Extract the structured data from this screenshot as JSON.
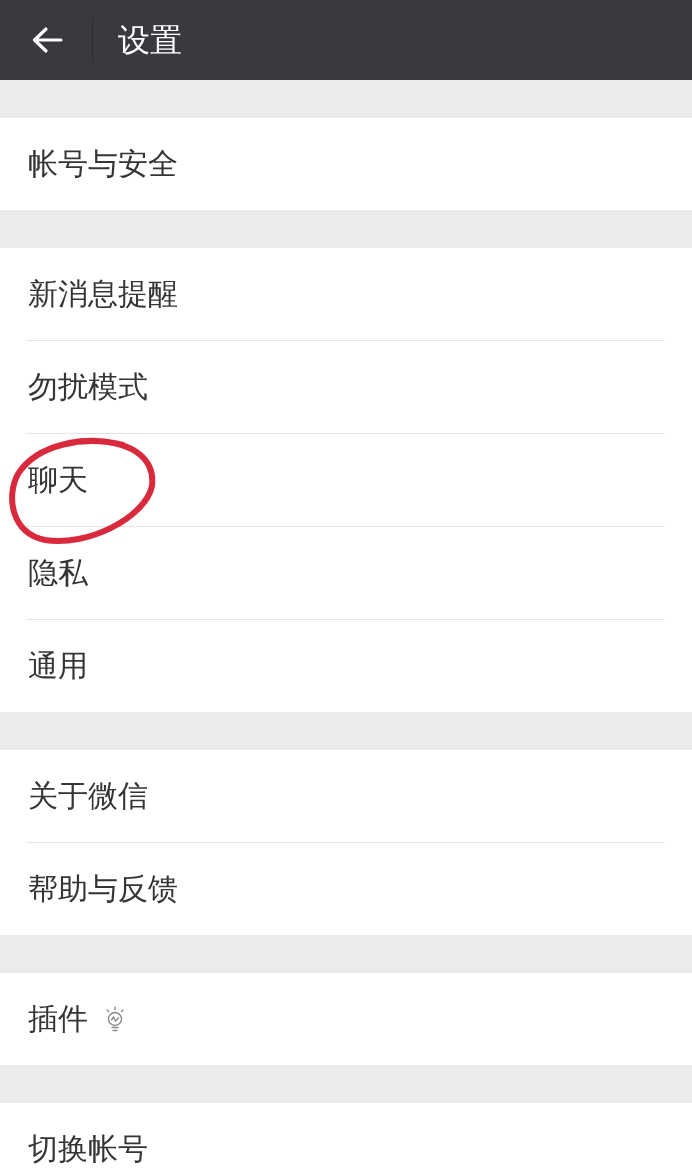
{
  "header": {
    "title": "设置"
  },
  "groups": [
    {
      "items": [
        {
          "label": "帐号与安全",
          "kind": "plain",
          "circled": false
        }
      ]
    },
    {
      "items": [
        {
          "label": "新消息提醒",
          "kind": "plain",
          "circled": false
        },
        {
          "label": "勿扰模式",
          "kind": "plain",
          "circled": false
        },
        {
          "label": "聊天",
          "kind": "plain",
          "circled": true
        },
        {
          "label": "隐私",
          "kind": "plain",
          "circled": false
        },
        {
          "label": "通用",
          "kind": "plain",
          "circled": false
        }
      ]
    },
    {
      "items": [
        {
          "label": "关于微信",
          "kind": "plain",
          "circled": false
        },
        {
          "label": "帮助与反馈",
          "kind": "plain",
          "circled": false
        }
      ]
    },
    {
      "items": [
        {
          "label": "插件",
          "kind": "icon",
          "circled": false
        }
      ]
    },
    {
      "items": [
        {
          "label": "切换帐号",
          "kind": "plain",
          "circled": false
        }
      ]
    }
  ]
}
